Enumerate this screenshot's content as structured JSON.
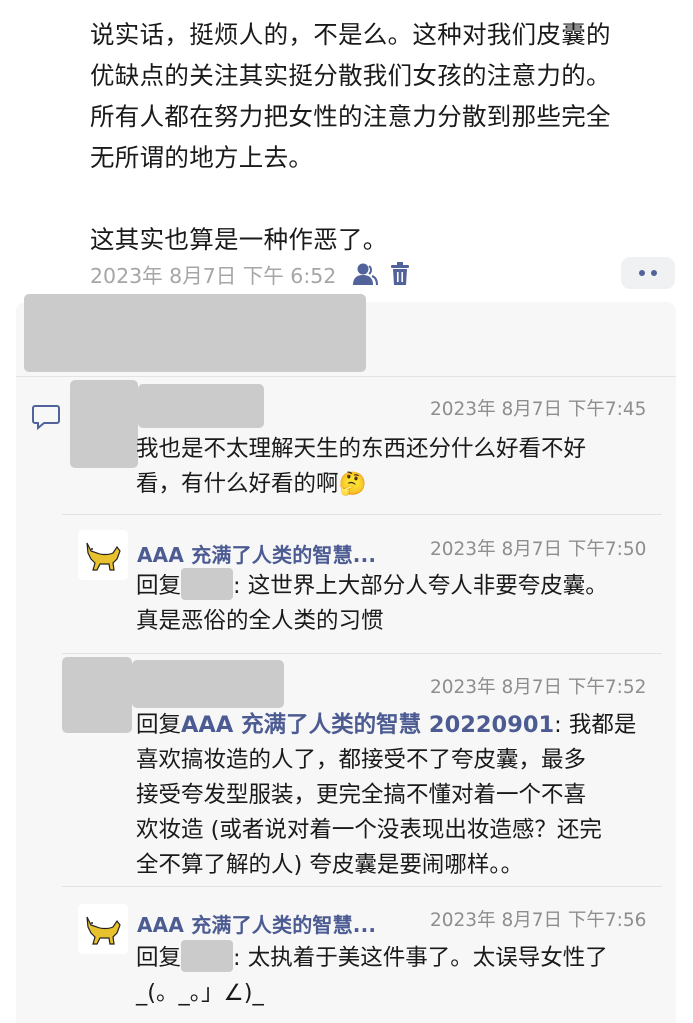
{
  "post": {
    "text": "说实话，挺烦人的，不是么。这种对我们皮囊的\n优缺点的关注其实挺分散我们女孩的注意力的。\n所有人都在努力把女性的注意力分散到那些完全\n无所谓的地方上去。\n\n这其实也算是一种作恶了。",
    "timestamp": "2023年 8月7日 下午 6:52",
    "icons": [
      "user-icon",
      "trash-icon",
      "more-icon"
    ]
  },
  "comments": [
    {
      "time": "2023年 8月7日 下午7:45",
      "text": "我也是不太理解天生的东西还分什么好看不好\n看，有什么好看的啊",
      "emoji": "🤔"
    },
    {
      "author": "AAA 充满了人类的智慧...",
      "time": "2023年 8月7日 下午7:50",
      "reply_prefix": "回复",
      "reply_text_1": ": 这世界上大部分人夸人非要夸皮囊。",
      "reply_text_2": "真是恶俗的全人类的习惯"
    },
    {
      "time": "2023年 8月7日 下午7:52",
      "reply_prefix": "回复",
      "mention": "AAA 充满了人类的智慧 20220901",
      "reply_text_1": ": 我都是",
      "reply_text_2": "喜欢搞妆造的人了，都接受不了夸皮囊，最多\n接受夸发型服装，更完全搞不懂对着一个不喜\n欢妆造 (或者说对着一个没表现出妆造感？还完\n全不算了解的人) 夸皮囊是要闹哪样。。"
    },
    {
      "author": "AAA 充满了人类的智慧...",
      "time": "2023年 8月7日 下午7:56",
      "reply_prefix": "回复",
      "reply_text_1": ": 太执着于美这件事了。太误导女性了",
      "reply_text_2": "_(。_。」∠)_"
    }
  ],
  "colors": {
    "accent": "#4c5b92",
    "meta": "#a6a6a6",
    "panel": "#f7f7f8",
    "redaction": "#cbcbcb"
  }
}
